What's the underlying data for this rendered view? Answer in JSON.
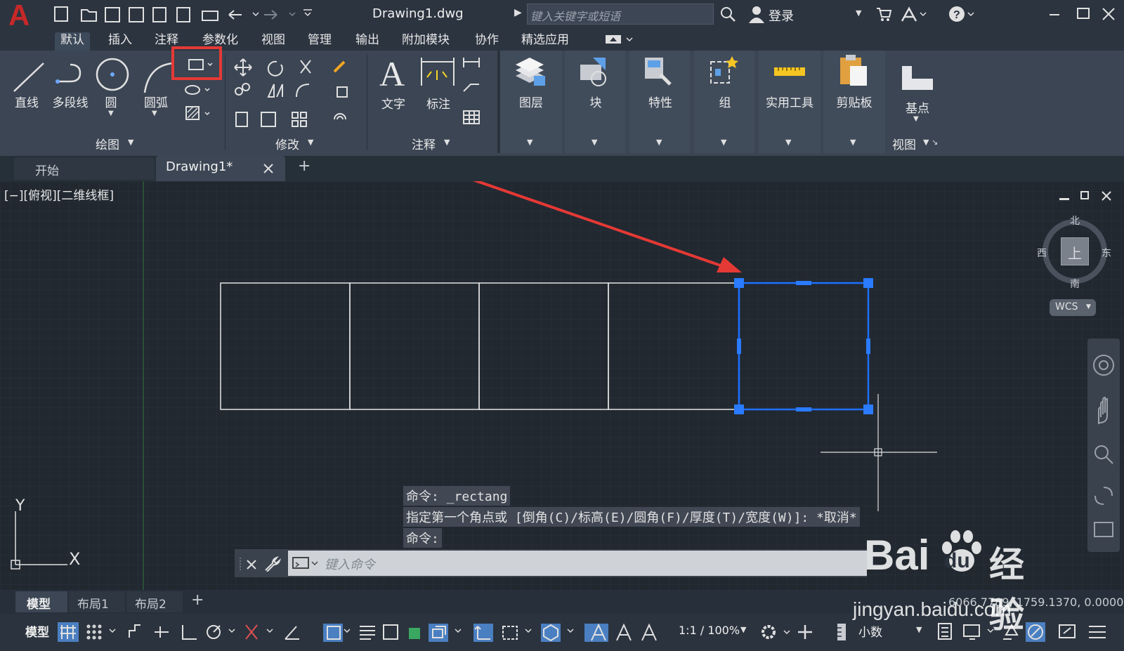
{
  "app": {
    "logo": "A",
    "file_title": "Drawing1.dwg",
    "search_placeholder": "键入关键字或短语",
    "login_label": "登录"
  },
  "menu": {
    "items": [
      "默认",
      "插入",
      "注释",
      "参数化",
      "视图",
      "管理",
      "输出",
      "附加模块",
      "协作",
      "精选应用"
    ]
  },
  "ribbon": {
    "draw": {
      "line": "直线",
      "polyline": "多段线",
      "circle": "圆",
      "arc": "圆弧",
      "title": "绘图"
    },
    "modify": {
      "title": "修改"
    },
    "annotation": {
      "text": "文字",
      "dimension": "标注",
      "title": "注释"
    },
    "layers": "图层",
    "block": "块",
    "properties": "特性",
    "groups": "组",
    "utilities": "实用工具",
    "clipboard": "剪贴板",
    "view": {
      "base": "基点",
      "title": "视图"
    }
  },
  "tabs": {
    "start": "开始",
    "drawing": "Drawing1*",
    "add": "+"
  },
  "viewport": {
    "label": "[−][俯视][二维线框]",
    "viewcube": {
      "north": "北",
      "south": "南",
      "east": "东",
      "west": "西",
      "top": "上",
      "wcs": "WCS"
    },
    "ucs_x": "X",
    "ucs_y": "Y"
  },
  "command": {
    "line1": "命令: _rectang",
    "line2": "指定第一个角点或 [倒角(C)/标高(E)/圆角(F)/厚度(T)/宽度(W)]: *取消*",
    "line3": "命令:",
    "placeholder": "键入命令"
  },
  "layouts": {
    "model": "模型",
    "layout1": "布局1",
    "layout2": "布局2",
    "add": "+"
  },
  "status": {
    "model": "模型",
    "scale": "1:1 / 100%",
    "units": "小数",
    "coords": "6066.7789, 1759.1370, 0.0000"
  },
  "watermark": {
    "brand": "Bai",
    "brand2": "du",
    "suffix": "经验",
    "url": "jingyan.baidu.com"
  },
  "colors": {
    "accent_red": "#e53935",
    "selection_blue": "#1e6fff",
    "grip_blue": "#2a7bff",
    "app_red": "#c62828"
  }
}
